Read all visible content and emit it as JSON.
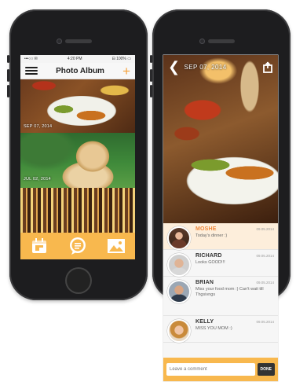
{
  "left_phone": {
    "status": {
      "carrier": "•••○○ ✉",
      "time": "4:20 PM",
      "battery": "⊟ 100% ▭"
    },
    "nav": {
      "title": "Photo Album",
      "add_icon": "plus-icon",
      "menu_icon": "hamburger-icon"
    },
    "photos": [
      {
        "date": "SEP 07, 2014",
        "subject": "food"
      },
      {
        "date": "JUL 02, 2014",
        "subject": "dog"
      },
      {
        "date": "",
        "subject": "city"
      }
    ],
    "tabs": [
      {
        "icon": "calendar-icon"
      },
      {
        "icon": "chat-bubble-icon"
      },
      {
        "icon": "image-icon"
      }
    ],
    "accent": "#f8b84e"
  },
  "right_phone": {
    "header": {
      "date": "SEP 07, 2014",
      "back_icon": "back-chevron-icon",
      "share_icon": "share-icon"
    },
    "comments": [
      {
        "name": "MOSHE",
        "date": "09.05.2014",
        "text": "Today's dinner :)",
        "active": true,
        "name_color": "#f0883a"
      },
      {
        "name": "RICHARD",
        "date": "09.05.2014",
        "text": "Looks GOOD!!!",
        "active": false
      },
      {
        "name": "BRIAN",
        "date": "09.05.2014",
        "text": "Miss your food mom :) Can't wait till Thgsivngs",
        "active": false
      },
      {
        "name": "KELLY",
        "date": "09.05.2014",
        "text": "MISS YOU MOM :)",
        "active": false
      }
    ],
    "composer": {
      "placeholder": "Leave a comment",
      "done_label": "DONE"
    }
  }
}
